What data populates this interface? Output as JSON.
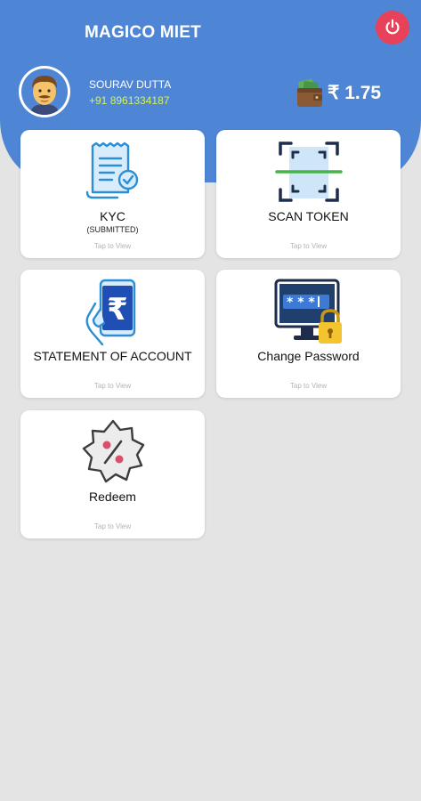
{
  "app": {
    "title": "MAGICO MIET"
  },
  "user": {
    "name": "SOURAV DUTTA",
    "phone": "+91 8961334187"
  },
  "wallet": {
    "balance": "₹ 1.75"
  },
  "cards": [
    {
      "title": "KYC",
      "subtitle": "(SUBMITTED)",
      "tap": "Tap to View",
      "icon": "kyc-document-icon"
    },
    {
      "title": "SCAN TOKEN",
      "tap": "Tap to View",
      "icon": "qr-scan-icon"
    },
    {
      "title": "STATEMENT OF ACCOUNT",
      "tap": "Tap to View",
      "icon": "rupee-phone-icon"
    },
    {
      "title": "Change Password",
      "tap": "Tap to View",
      "icon": "password-monitor-icon"
    },
    {
      "title": "Redeem",
      "tap": "Tap to View",
      "icon": "discount-badge-icon"
    }
  ],
  "colors": {
    "header": "#4e86d5",
    "background": "#e4e4e4",
    "power": "#e8425a",
    "phone": "#d6f25a"
  }
}
